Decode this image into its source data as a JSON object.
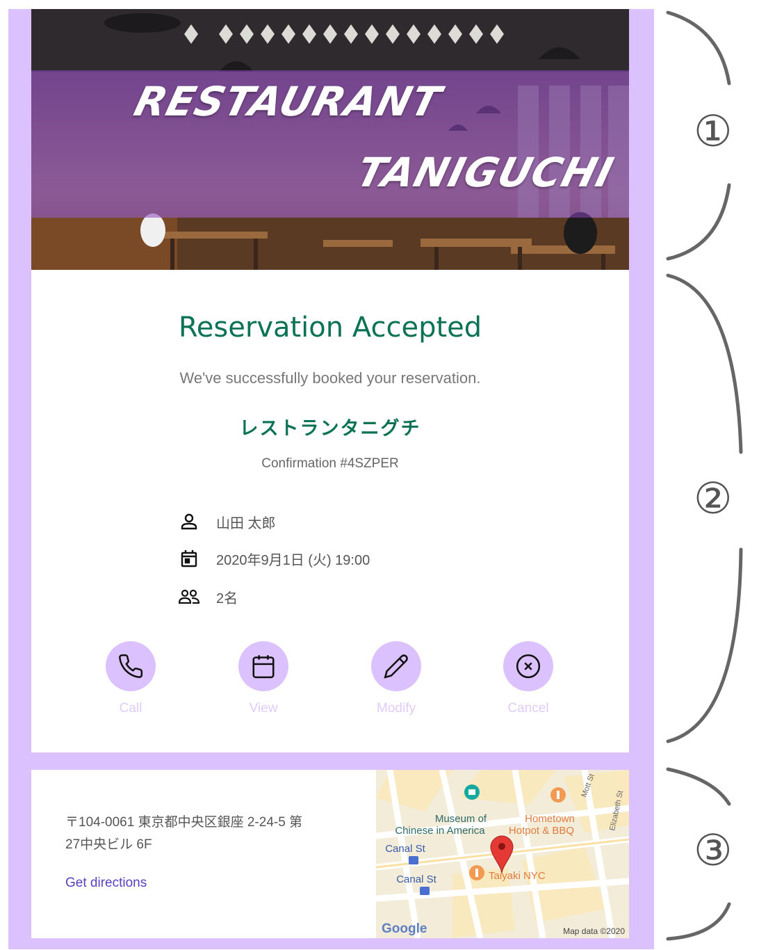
{
  "hero": {
    "title_line1": "RESTAURANT",
    "title_line2": "TANIGUCHI"
  },
  "reservation": {
    "title": "Reservation Accepted",
    "subtitle": "We've successfully booked your reservation.",
    "restaurant_name": "レストランタニグチ",
    "confirmation": "Confirmation #4SZPER",
    "guest_name": "山田 太郎",
    "datetime": "2020年9月1日 (火) 19:00",
    "party_size": "2名",
    "actions": [
      {
        "label": "Call",
        "icon": "phone-icon"
      },
      {
        "label": "View",
        "icon": "calendar-icon"
      },
      {
        "label": "Modify",
        "icon": "pencil-icon"
      },
      {
        "label": "Cancel",
        "icon": "cancel-circle-icon"
      }
    ]
  },
  "location": {
    "address_line1": "〒104-0061 東京都中央区銀座 2-24-5 第",
    "address_line2": "27中央ビル 6F",
    "directions_label": "Get directions",
    "map": {
      "poi_museum_line1": "Museum of",
      "poi_museum_line2": "Chinese in America",
      "poi_hotpot_line1": "Hometown",
      "poi_hotpot_line2": "Hotpot & BBQ",
      "station1": "Canal St",
      "station2": "Canal St",
      "poi_taiyaki": "Taiyaki NYC",
      "street_mott": "Mott St",
      "street_elizabeth": "Elizabeth St",
      "logo": "Google",
      "attribution": "Map data ©2020"
    }
  },
  "annotations": {
    "section1": "①",
    "section2": "②",
    "section3": "③"
  },
  "colors": {
    "frame": "#dcc1ff",
    "accent_green": "#0b7256",
    "action_label": "#e0cdf7",
    "link": "#5a3fc0"
  }
}
